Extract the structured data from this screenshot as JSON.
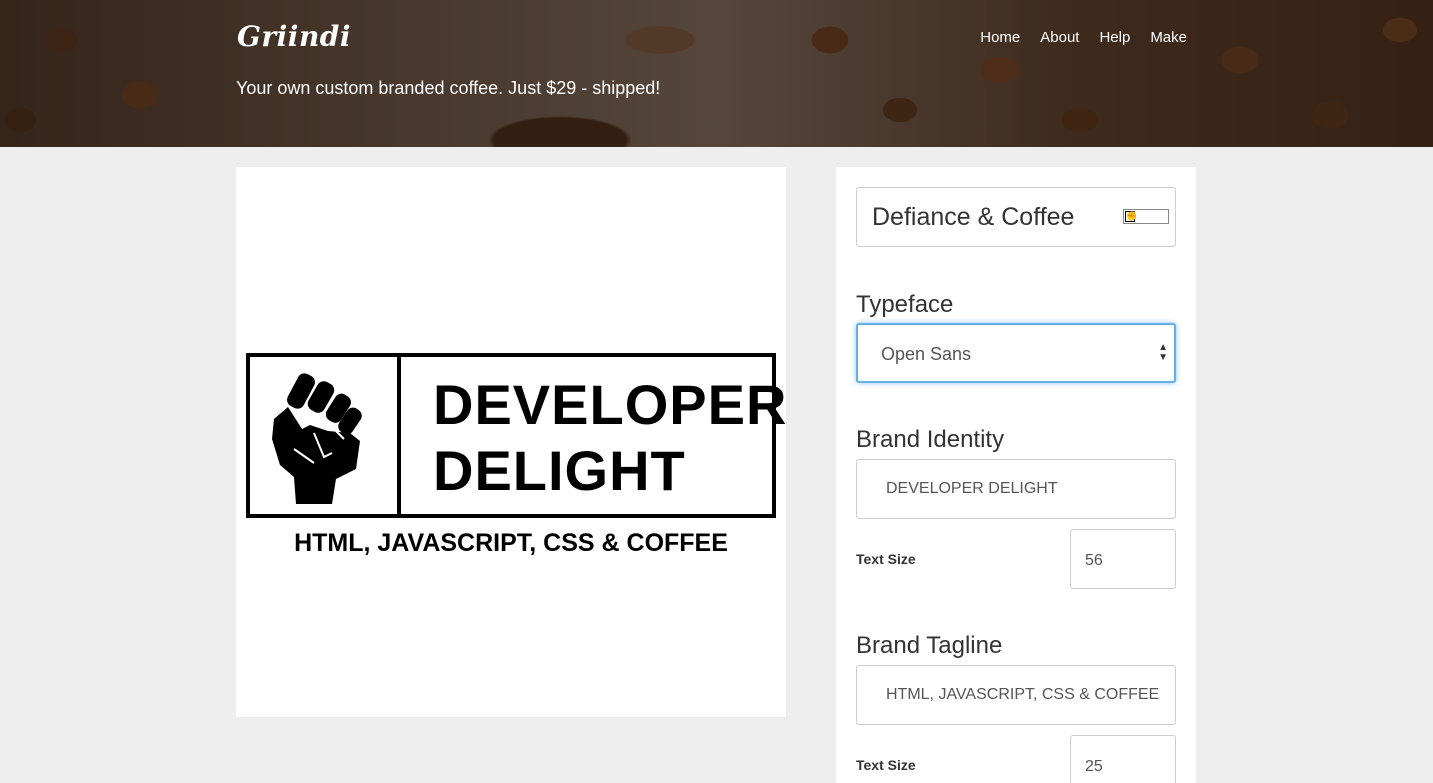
{
  "header": {
    "logo": "Griindi",
    "tagline": "Your own custom branded coffee. Just $29 - shipped!",
    "nav": [
      "Home",
      "About",
      "Help",
      "Make"
    ]
  },
  "preview": {
    "brand_line_1": "DEVELOPER",
    "brand_line_2": "DELIGHT",
    "tagline": "HTML, JAVASCRIPT, CSS & COFFEE",
    "icon": "raised-fist-icon"
  },
  "form": {
    "design_name": "Defiance & Coffee",
    "typeface_title": "Typeface",
    "typeface_value": "Open Sans",
    "identity_title": "Brand Identity",
    "identity_value": "DEVELOPER DELIGHT",
    "identity_size_label": "Text Size",
    "identity_size_value": "56",
    "tagline_title": "Brand Tagline",
    "tagline_value": "HTML, JAVASCRIPT, CSS & COFFEE",
    "tagline_size_label": "Text Size",
    "tagline_size_value": "25"
  },
  "colors": {
    "page_bg": "#eeeeee",
    "focus_border": "#66afe9"
  }
}
